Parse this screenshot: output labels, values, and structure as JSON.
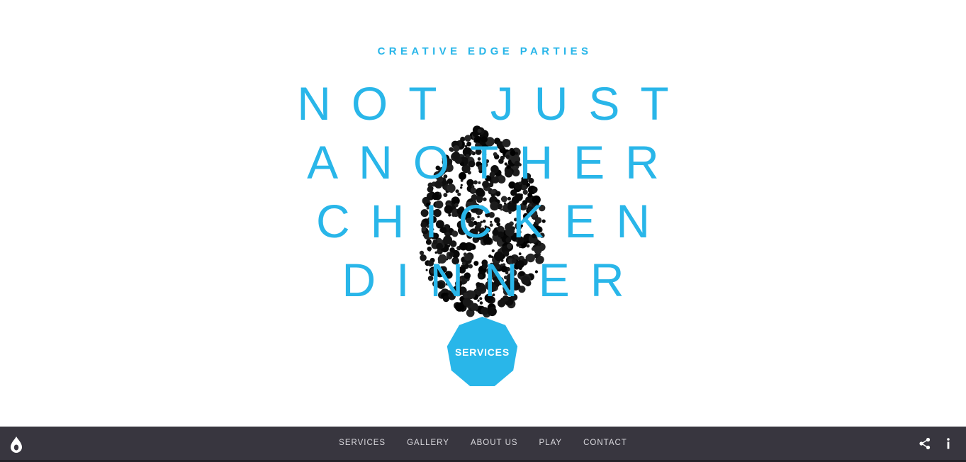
{
  "hero": {
    "tagline": "CREATIVE EDGE PARTIES",
    "headline_lines": [
      "NOT JUST",
      "ANOTHER",
      "CHICKEN",
      "DINNER"
    ],
    "cta_label": "SERVICES"
  },
  "nav": {
    "items": [
      "SERVICES",
      "GALLERY",
      "ABOUT US",
      "PLAY",
      "CONTACT"
    ]
  },
  "icons": {
    "logo": "drop-logo-icon",
    "share": "share-icon",
    "info": "info-icon",
    "egg": "dotted-egg-graphic"
  },
  "colors": {
    "accent": "#29b6e9",
    "bar": "#38363f",
    "nav_text": "#d9d8dd",
    "dots": "#111111"
  }
}
